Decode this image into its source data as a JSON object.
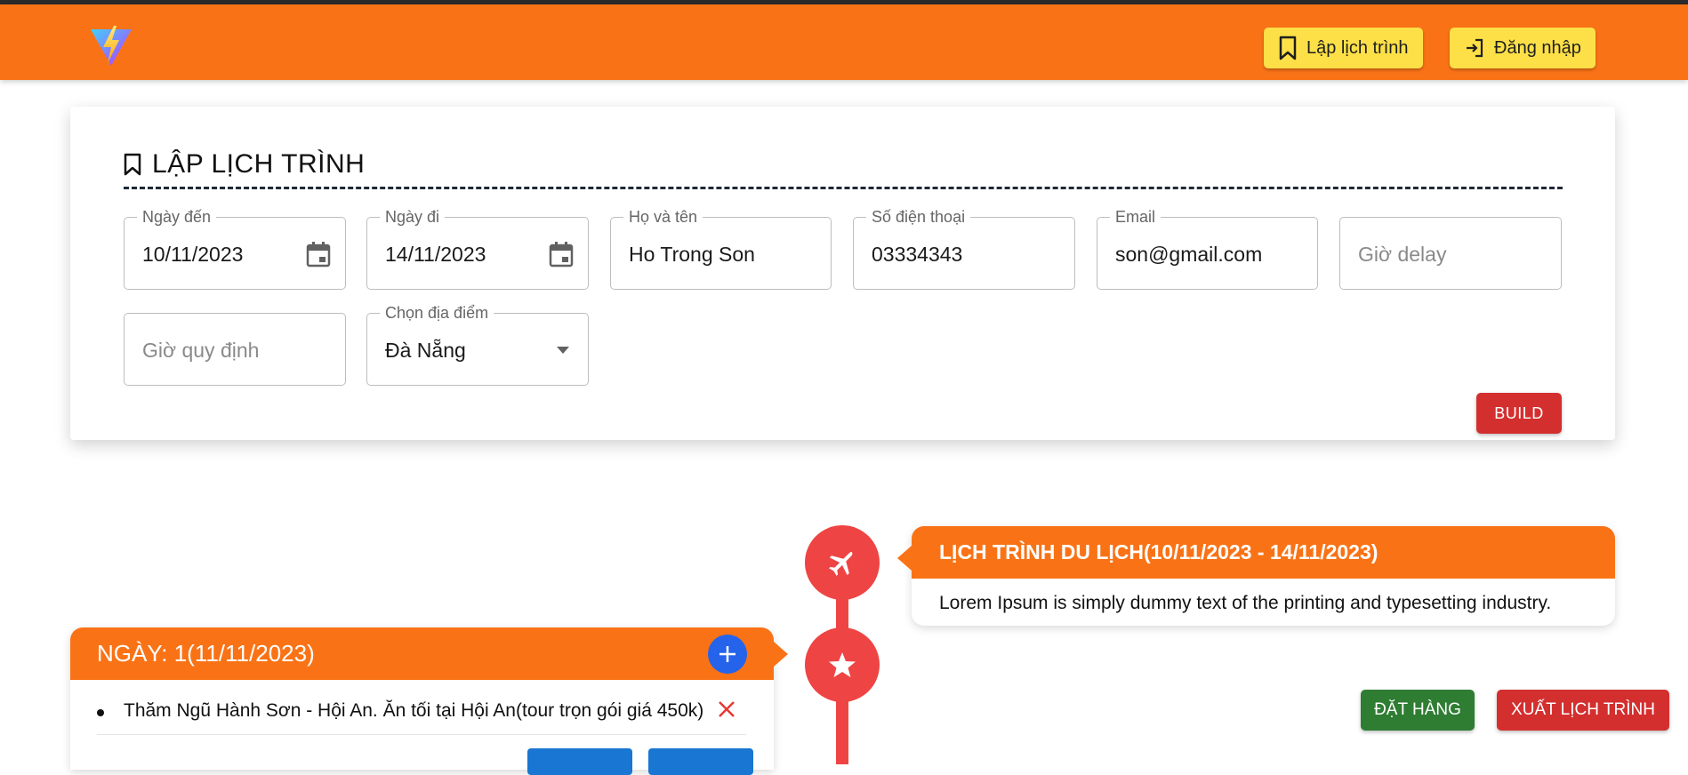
{
  "navbar": {
    "logo_icon": "vite-logo-icon",
    "schedule_label": "Lập lịch trình",
    "login_label": "Đăng nhập",
    "bg_color": "#f97316",
    "button_color": "#fde047"
  },
  "form": {
    "title": "LẬP LỊCH TRÌNH",
    "arrival": {
      "label": "Ngày đến",
      "value": "10/11/2023"
    },
    "departure": {
      "label": "Ngày đi",
      "value": "14/11/2023"
    },
    "name": {
      "label": "Họ và tên",
      "value": "Ho Trong Son"
    },
    "phone": {
      "label": "Số điện thoại",
      "value": "03334343"
    },
    "email": {
      "label": "Email",
      "value": "son@gmail.com"
    },
    "delay": {
      "placeholder": "Giờ delay"
    },
    "fixed_time": {
      "placeholder": "Giờ quy định"
    },
    "location": {
      "label": "Chọn địa điểm",
      "value": "Đà Nẵng"
    },
    "build_label": "BUILD"
  },
  "timeline": {
    "trip": {
      "title": "LỊCH TRÌNH DU LỊCH(10/11/2023 - 14/11/2023)",
      "description": "Lorem Ipsum is simply dummy text of the printing and typesetting industry."
    },
    "day": {
      "title": "NGÀY: 1(11/11/2023)",
      "activities": [
        "Thăm Ngũ Hành Sơn - Hội An. Ăn tối tại Hội An(tour trọn gói giá 450k)"
      ]
    }
  },
  "actions": {
    "order_label": "ĐẶT HÀNG",
    "export_label": "XUẤT LỊCH TRÌNH"
  },
  "colors": {
    "accent": "#f97316",
    "timeline_red": "#ef4444",
    "build_red": "#d32f2f",
    "order_green": "#2e7d32",
    "plus_blue": "#2563eb"
  }
}
